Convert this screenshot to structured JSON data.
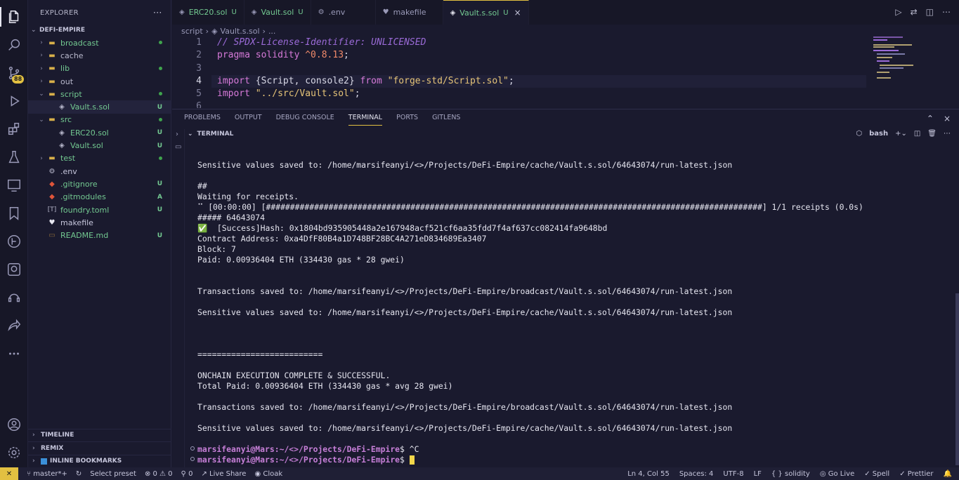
{
  "sidebar": {
    "title": "EXPLORER",
    "root": "DEFI-EMPIRE",
    "items": [
      {
        "label": "broadcast",
        "type": "folder",
        "status": "dot"
      },
      {
        "label": "cache",
        "type": "folder",
        "status": ""
      },
      {
        "label": "lib",
        "type": "folder",
        "status": "dot"
      },
      {
        "label": "out",
        "type": "folder",
        "status": ""
      },
      {
        "label": "script",
        "type": "folder-open",
        "status": "dot"
      },
      {
        "label": "Vault.s.sol",
        "type": "sol",
        "status": "U"
      },
      {
        "label": "src",
        "type": "folder-open",
        "status": "dot"
      },
      {
        "label": "ERC20.sol",
        "type": "sol",
        "status": "U"
      },
      {
        "label": "Vault.sol",
        "type": "sol",
        "status": "U"
      },
      {
        "label": "test",
        "type": "folder",
        "status": "dot"
      },
      {
        "label": ".env",
        "type": "gear",
        "status": ""
      },
      {
        "label": ".gitignore",
        "type": "git",
        "status": "U"
      },
      {
        "label": ".gitmodules",
        "type": "git",
        "status": "A"
      },
      {
        "label": "foundry.toml",
        "type": "toml",
        "status": "U"
      },
      {
        "label": "makefile",
        "type": "heart",
        "status": ""
      },
      {
        "label": "README.md",
        "type": "md",
        "status": "U"
      }
    ],
    "sections": [
      "TIMELINE",
      "REMIX",
      "INLINE BOOKMARKS"
    ]
  },
  "activity": {
    "badge": "88"
  },
  "tabs": [
    {
      "label": "ERC20.sol",
      "status": "U"
    },
    {
      "label": "Vault.sol",
      "status": "U"
    },
    {
      "label": ".env",
      "status": ""
    },
    {
      "label": "makefile",
      "status": ""
    },
    {
      "label": "Vault.s.sol",
      "status": "U"
    }
  ],
  "breadcrumb": {
    "folder": "script",
    "file": "Vault.s.sol",
    "more": "..."
  },
  "editor": {
    "line_numbers": [
      "1",
      "2",
      "3",
      "4",
      "5",
      "6"
    ],
    "line1": "// SPDX-License-Identifier: UNLICENSED",
    "line2_kw": "pragma solidity",
    "line2_ver": "^0.8.13",
    "line2_end": ";",
    "line4_kw": "import",
    "line4_mid": " {Script, console2} ",
    "line4_from": "from",
    "line4_str": "\"forge-std/Script.sol\"",
    "line4_end": ";",
    "line5_kw": "import",
    "line5_str": "\"../src/Vault.sol\"",
    "line5_end": ";"
  },
  "panel": {
    "tabs": [
      "PROBLEMS",
      "OUTPUT",
      "DEBUG CONSOLE",
      "TERMINAL",
      "PORTS",
      "GITLENS"
    ],
    "terminal_title": "TERMINAL",
    "shell": "bash"
  },
  "terminal": {
    "lines": [
      "Sensitive values saved to: /home/marsifeanyi/<>/Projects/DeFi-Empire/cache/Vault.s.sol/64643074/run-latest.json",
      "",
      "##",
      "Waiting for receipts.",
      "⠉ [00:00:00] [#######################################################################################################] 1/1 receipts (0.0s)",
      "##### 64643074",
      "✅  [Success]Hash: 0x1804bd935905448a2e167948acf521cf6aa35fdd7f4af637cc082414fa9648bd",
      "Contract Address: 0xa4DfF80B4a1D748BF28BC4A271eD834689Ea3407",
      "Block: 7",
      "Paid: 0.00936404 ETH (334430 gas * 28 gwei)",
      "",
      "",
      "Transactions saved to: /home/marsifeanyi/<>/Projects/DeFi-Empire/broadcast/Vault.s.sol/64643074/run-latest.json",
      "",
      "Sensitive values saved to: /home/marsifeanyi/<>/Projects/DeFi-Empire/cache/Vault.s.sol/64643074/run-latest.json",
      "",
      "",
      "",
      "==========================",
      "",
      "ONCHAIN EXECUTION COMPLETE & SUCCESSFUL.",
      "Total Paid: 0.00936404 ETH (334430 gas * avg 28 gwei)",
      "",
      "Transactions saved to: /home/marsifeanyi/<>/Projects/DeFi-Empire/broadcast/Vault.s.sol/64643074/run-latest.json",
      "",
      "Sensitive values saved to: /home/marsifeanyi/<>/Projects/DeFi-Empire/cache/Vault.s.sol/64643074/run-latest.json"
    ],
    "prompt1_user": "marsifeanyi@Mars",
    "prompt1_path": ":~/<>/Projects/DeFi-Empire",
    "prompt1_cmd": "$ ^C",
    "prompt2_user": "marsifeanyi@Mars",
    "prompt2_path": ":~/<>/Projects/DeFi-Empire",
    "prompt2_cmd": "$ "
  },
  "statusbar": {
    "branch": "master*+",
    "preset": "Select preset",
    "problems": "⊗ 0 ⚠ 0",
    "ports": "0",
    "live_share": "Live Share",
    "cloak": "Cloak",
    "position": "Ln 4, Col 55",
    "spaces": "Spaces: 4",
    "encoding": "UTF-8",
    "eol": "LF",
    "language": "solidity",
    "golive": "Go Live",
    "spell": "Spell",
    "prettier": "Prettier"
  },
  "colors": {
    "accent": "#e2c041",
    "added": "#73c991",
    "prompt": "#c77fd8"
  }
}
